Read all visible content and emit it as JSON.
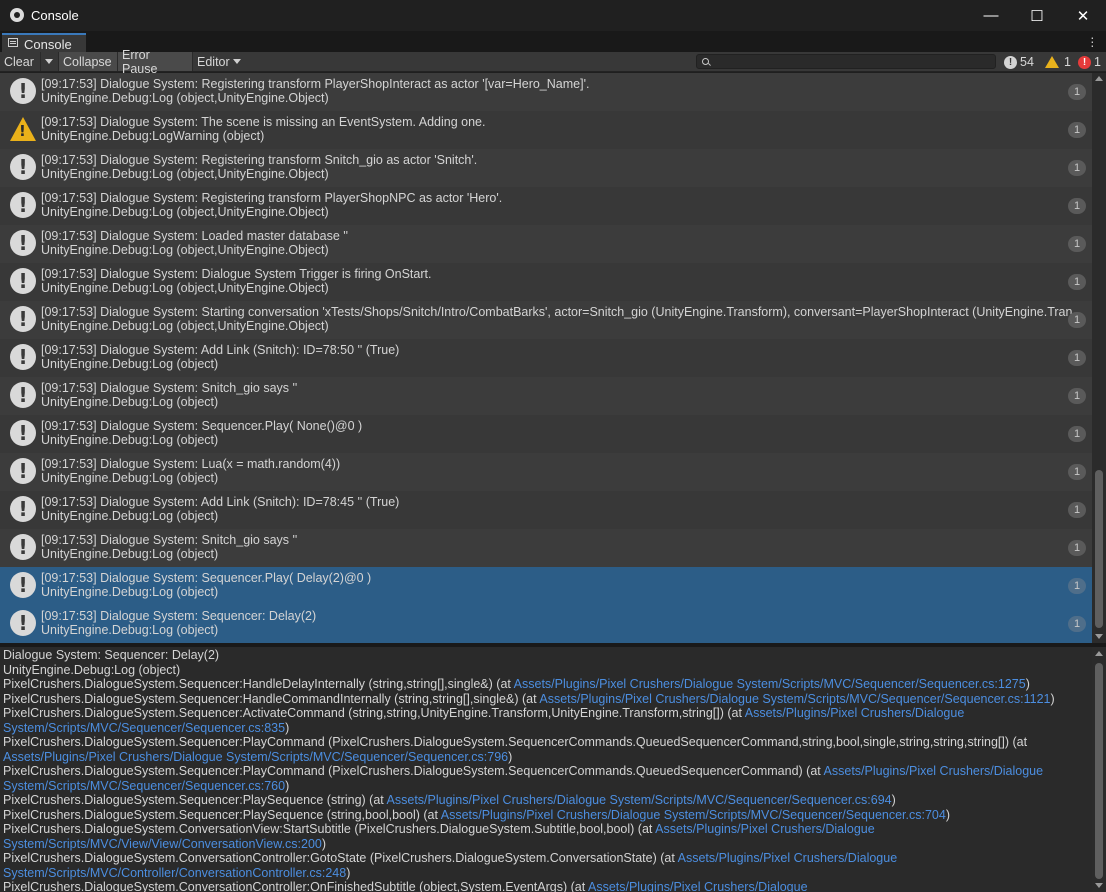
{
  "window": {
    "title": "Console",
    "controls": {
      "minimize": "—",
      "maximize": "☐",
      "close": "✕"
    }
  },
  "tab": {
    "label": "Console"
  },
  "toolbar": {
    "clear": "Clear",
    "collapse": "Collapse",
    "error_pause": "Error Pause",
    "editor": "Editor",
    "search_placeholder": "",
    "counts": {
      "info": "54",
      "warning": "1",
      "error": "1"
    }
  },
  "logs": [
    {
      "type": "info",
      "line1": "[09:17:53] Dialogue System: Registering transform PlayerShopInteract as actor '[var=Hero_Name]'.",
      "line2": "UnityEngine.Debug:Log (object,UnityEngine.Object)",
      "count": "1",
      "selected": false
    },
    {
      "type": "warning",
      "line1": "[09:17:53] Dialogue System: The scene is missing an EventSystem. Adding one.",
      "line2": "UnityEngine.Debug:LogWarning (object)",
      "count": "1",
      "selected": false
    },
    {
      "type": "info",
      "line1": "[09:17:53] Dialogue System: Registering transform Snitch_gio as actor 'Snitch'.",
      "line2": "UnityEngine.Debug:Log (object,UnityEngine.Object)",
      "count": "1",
      "selected": false
    },
    {
      "type": "info",
      "line1": "[09:17:53] Dialogue System: Registering transform PlayerShopNPC as actor 'Hero'.",
      "line2": "UnityEngine.Debug:Log (object,UnityEngine.Object)",
      "count": "1",
      "selected": false
    },
    {
      "type": "info",
      "line1": "[09:17:53] Dialogue System: Loaded master database ''",
      "line2": "UnityEngine.Debug:Log (object,UnityEngine.Object)",
      "count": "1",
      "selected": false
    },
    {
      "type": "info",
      "line1": "[09:17:53] Dialogue System: Dialogue System Trigger is firing OnStart.",
      "line2": "UnityEngine.Debug:Log (object,UnityEngine.Object)",
      "count": "1",
      "selected": false
    },
    {
      "type": "info",
      "line1": "[09:17:53] Dialogue System: Starting conversation 'xTests/Shops/Snitch/Intro/CombatBarks', actor=Snitch_gio (UnityEngine.Transform), conversant=PlayerShopInteract (UnityEngine.Tran",
      "line2": "UnityEngine.Debug:Log (object,UnityEngine.Object)",
      "count": "1",
      "selected": false
    },
    {
      "type": "info",
      "line1": "[09:17:53] Dialogue System: Add Link (Snitch): ID=78:50 '' (True)",
      "line2": "UnityEngine.Debug:Log (object)",
      "count": "1",
      "selected": false
    },
    {
      "type": "info",
      "line1": "[09:17:53] Dialogue System: Snitch_gio says ''",
      "line2": "UnityEngine.Debug:Log (object)",
      "count": "1",
      "selected": false
    },
    {
      "type": "info",
      "line1": "[09:17:53] Dialogue System: Sequencer.Play( None()@0 )",
      "line2": "UnityEngine.Debug:Log (object)",
      "count": "1",
      "selected": false
    },
    {
      "type": "info",
      "line1": "[09:17:53] Dialogue System: Lua(x = math.random(4))",
      "line2": "UnityEngine.Debug:Log (object)",
      "count": "1",
      "selected": false
    },
    {
      "type": "info",
      "line1": "[09:17:53] Dialogue System: Add Link (Snitch): ID=78:45 '' (True)",
      "line2": "UnityEngine.Debug:Log (object)",
      "count": "1",
      "selected": false
    },
    {
      "type": "info",
      "line1": "[09:17:53] Dialogue System: Snitch_gio says ''",
      "line2": "UnityEngine.Debug:Log (object)",
      "count": "1",
      "selected": false
    },
    {
      "type": "info",
      "line1": "[09:17:53] Dialogue System: Sequencer.Play( Delay(2)@0 )",
      "line2": "UnityEngine.Debug:Log (object)",
      "count": "1",
      "selected": true
    },
    {
      "type": "info",
      "line1": "[09:17:53] Dialogue System: Sequencer: Delay(2)",
      "line2": "UnityEngine.Debug:Log (object)",
      "count": "1",
      "selected": true
    }
  ],
  "detail": [
    {
      "text": "Dialogue System: Sequencer: Delay(2)",
      "link": "",
      "tail": ""
    },
    {
      "text": "UnityEngine.Debug:Log (object)",
      "link": "",
      "tail": ""
    },
    {
      "text": "PixelCrushers.DialogueSystem.Sequencer:HandleDelayInternally (string,string[],single&) (at ",
      "link": "Assets/Plugins/Pixel Crushers/Dialogue System/Scripts/MVC/Sequencer/Sequencer.cs:1275",
      "tail": ")"
    },
    {
      "text": "PixelCrushers.DialogueSystem.Sequencer:HandleCommandInternally (string,string[],single&) (at ",
      "link": "Assets/Plugins/Pixel Crushers/Dialogue System/Scripts/MVC/Sequencer/Sequencer.cs:1121",
      "tail": ")"
    },
    {
      "text": "PixelCrushers.DialogueSystem.Sequencer:ActivateCommand (string,string,UnityEngine.Transform,UnityEngine.Transform,string[]) (at ",
      "link": "Assets/Plugins/Pixel Crushers/Dialogue",
      "tail": ""
    },
    {
      "text": "",
      "link": "System/Scripts/MVC/Sequencer/Sequencer.cs:835",
      "tail": ")"
    },
    {
      "text": "PixelCrushers.DialogueSystem.Sequencer:PlayCommand (PixelCrushers.DialogueSystem.SequencerCommands.QueuedSequencerCommand,string,bool,single,string,string,string[]) (at",
      "link": "",
      "tail": ""
    },
    {
      "text": "",
      "link": "Assets/Plugins/Pixel Crushers/Dialogue System/Scripts/MVC/Sequencer/Sequencer.cs:796",
      "tail": ")"
    },
    {
      "text": "PixelCrushers.DialogueSystem.Sequencer:PlayCommand (PixelCrushers.DialogueSystem.SequencerCommands.QueuedSequencerCommand) (at ",
      "link": "Assets/Plugins/Pixel Crushers/Dialogue",
      "tail": ""
    },
    {
      "text": "",
      "link": "System/Scripts/MVC/Sequencer/Sequencer.cs:760",
      "tail": ")"
    },
    {
      "text": "PixelCrushers.DialogueSystem.Sequencer:PlaySequence (string) (at ",
      "link": "Assets/Plugins/Pixel Crushers/Dialogue System/Scripts/MVC/Sequencer/Sequencer.cs:694",
      "tail": ")"
    },
    {
      "text": "PixelCrushers.DialogueSystem.Sequencer:PlaySequence (string,bool,bool) (at ",
      "link": "Assets/Plugins/Pixel Crushers/Dialogue System/Scripts/MVC/Sequencer/Sequencer.cs:704",
      "tail": ")"
    },
    {
      "text": "PixelCrushers.DialogueSystem.ConversationView:StartSubtitle (PixelCrushers.DialogueSystem.Subtitle,bool,bool) (at ",
      "link": "Assets/Plugins/Pixel Crushers/Dialogue",
      "tail": ""
    },
    {
      "text": "",
      "link": "System/Scripts/MVC/View/View/ConversationView.cs:200",
      "tail": ")"
    },
    {
      "text": "PixelCrushers.DialogueSystem.ConversationController:GotoState (PixelCrushers.DialogueSystem.ConversationState) (at ",
      "link": "Assets/Plugins/Pixel Crushers/Dialogue",
      "tail": ""
    },
    {
      "text": "",
      "link": "System/Scripts/MVC/Controller/ConversationController.cs:248",
      "tail": ")"
    },
    {
      "text": "PixelCrushers.DialogueSystem.ConversationController:OnFinishedSubtitle (object,System.EventArgs) (at ",
      "link": "Assets/Plugins/Pixel Crushers/Dialogue",
      "tail": ""
    }
  ],
  "colors": {
    "accent": "#3a79bb",
    "selected_row": "#2c5d87",
    "link": "#4c8ee0",
    "warning": "#e9b21c",
    "error": "#e63b3b"
  }
}
